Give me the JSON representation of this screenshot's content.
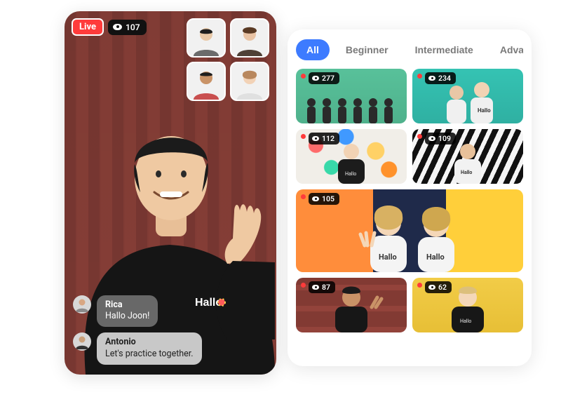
{
  "live": {
    "badge_label": "Live",
    "viewer_count": "107",
    "participants": [
      {
        "name": "participant-1"
      },
      {
        "name": "participant-2"
      },
      {
        "name": "participant-3"
      },
      {
        "name": "participant-4"
      }
    ],
    "host_brand": "Hallo",
    "chat": [
      {
        "author": "Rica",
        "message": "Hallo Joon!"
      },
      {
        "author": "Antonio",
        "message": "Let's practice together."
      }
    ]
  },
  "gallery": {
    "tabs": [
      {
        "label": "All",
        "active": true
      },
      {
        "label": "Beginner",
        "active": false
      },
      {
        "label": "Intermediate",
        "active": false
      },
      {
        "label": "Advanced",
        "active": false
      }
    ],
    "streams": [
      {
        "viewers": "277"
      },
      {
        "viewers": "234"
      },
      {
        "viewers": "112"
      },
      {
        "viewers": "109"
      },
      {
        "viewers": "105"
      },
      {
        "viewers": "87"
      },
      {
        "viewers": "62"
      }
    ]
  }
}
